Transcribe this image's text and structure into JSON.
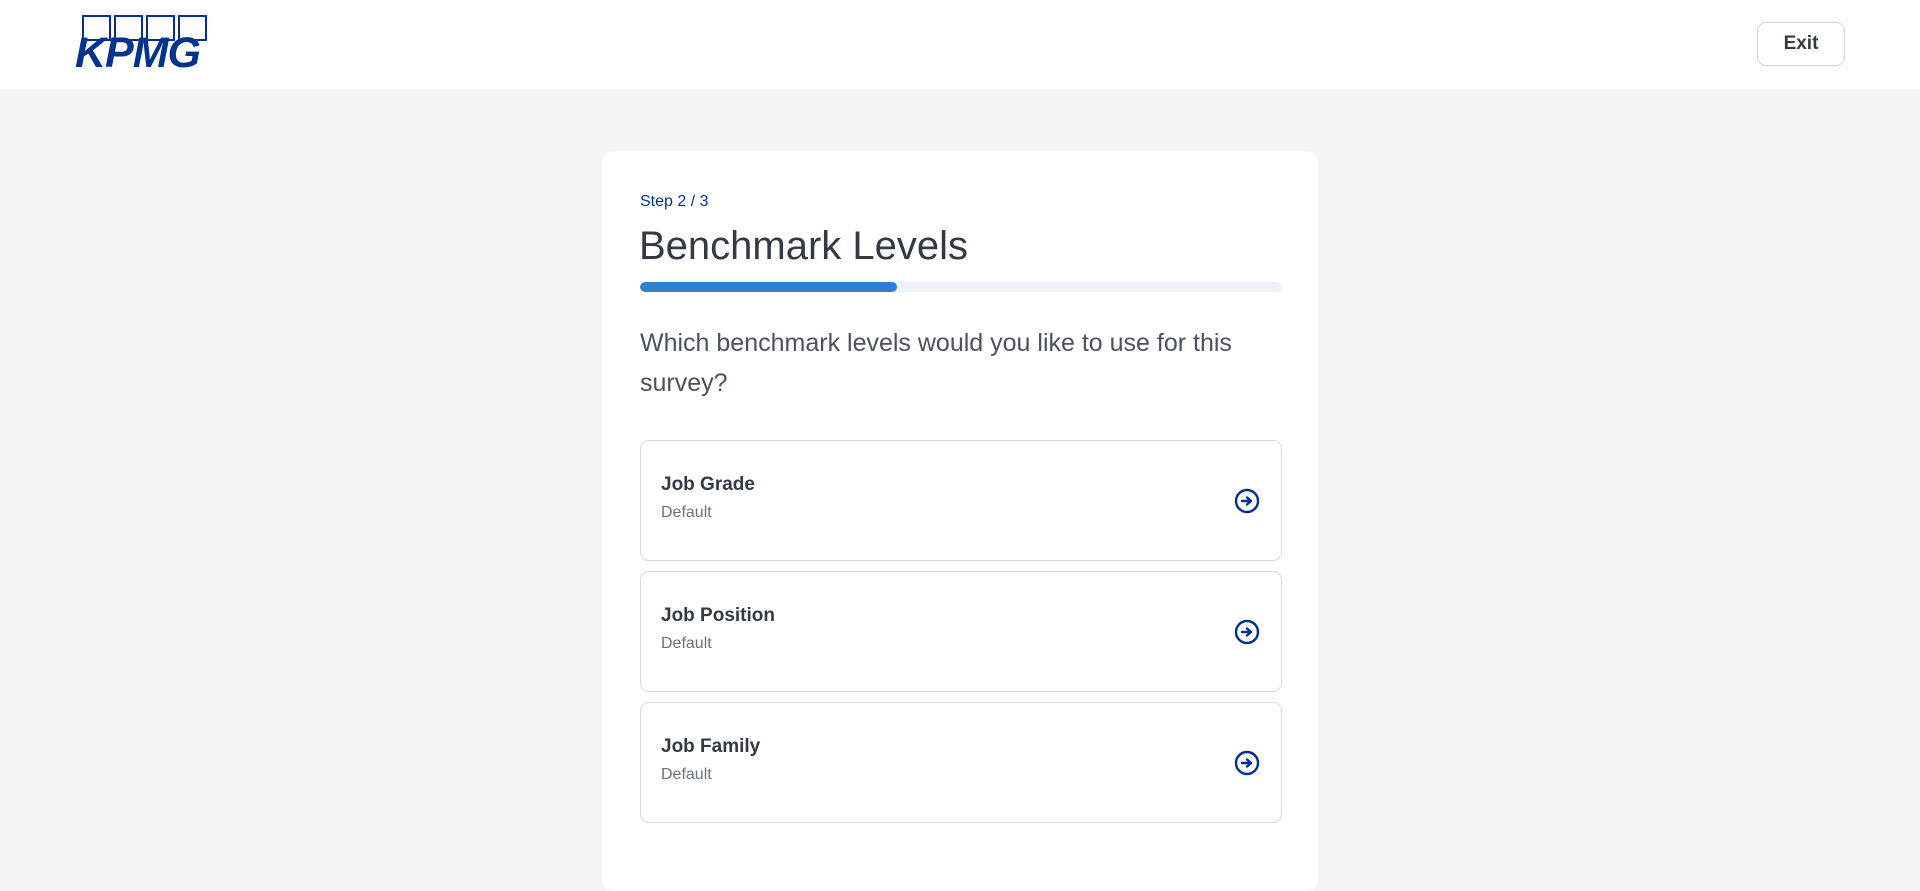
{
  "header": {
    "logo_text": "KPMG",
    "exit_label": "Exit"
  },
  "colors": {
    "brand": "#00338d",
    "progress": "#2f80d0",
    "background": "#f4f4f4"
  },
  "wizard": {
    "step": "Step 2 / 3",
    "title": "Benchmark Levels",
    "progress_fraction": 0.4,
    "question": "Which benchmark levels would you like to use for this survey?",
    "options": [
      {
        "title": "Job Grade",
        "subtitle": "Default",
        "icon": "arrow-right-circle-icon"
      },
      {
        "title": "Job Position",
        "subtitle": "Default",
        "icon": "arrow-right-circle-icon"
      },
      {
        "title": "Job Family",
        "subtitle": "Default",
        "icon": "arrow-right-circle-icon"
      }
    ]
  }
}
